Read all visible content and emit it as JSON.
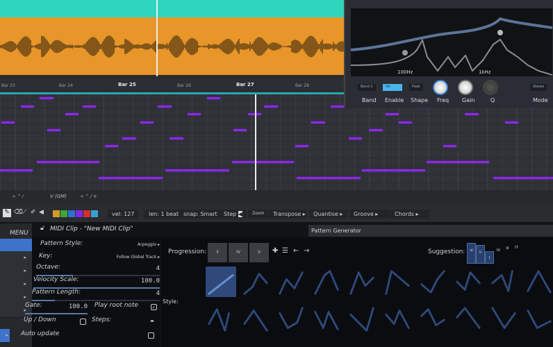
{
  "arrangement": {
    "track_colors": {
      "top": "#2fd6bd",
      "audio_clip": "#e8962a"
    }
  },
  "eq_plugin": {
    "freq_labels": [
      "100Hz",
      "1kHz"
    ],
    "controls": [
      "Band",
      "Enable",
      "Shape",
      "Freq",
      "Gain",
      "Q",
      "Mode"
    ],
    "buttons": [
      "Band 1",
      "On",
      "Peak",
      "Stereo"
    ]
  },
  "ruler": {
    "bars": [
      "Bar 23",
      "Bar 24",
      "Bar 25",
      "Bar 26",
      "Bar 27",
      "Bar 28"
    ],
    "major_bars": [
      "Bar 25",
      "Bar 27"
    ]
  },
  "piano_roll": {
    "note_color": "#8a2be2",
    "playhead_beat": 21.5,
    "notes": [
      {
        "start": 0.1,
        "len": 1,
        "row": 3
      },
      {
        "start": 1.4,
        "len": 1,
        "row": 1
      },
      {
        "start": 2.7,
        "len": 1,
        "row": 0
      },
      {
        "start": 3.2,
        "len": 1,
        "row": 4
      },
      {
        "start": 4.4,
        "len": 1,
        "row": 2
      },
      {
        "start": 5.6,
        "len": 1,
        "row": 1
      },
      {
        "start": 7.1,
        "len": 1,
        "row": 6
      },
      {
        "start": 8.3,
        "len": 1,
        "row": 5
      },
      {
        "start": 9.5,
        "len": 1,
        "row": 3
      },
      {
        "start": 10.7,
        "len": 1,
        "row": 1
      },
      {
        "start": 11.5,
        "len": 1,
        "row": 5
      },
      {
        "start": 12.7,
        "len": 1,
        "row": 2
      },
      {
        "start": 14.0,
        "len": 1,
        "row": 0
      },
      {
        "start": 15.8,
        "len": 1,
        "row": 4
      },
      {
        "start": 16.8,
        "len": 1,
        "row": 2
      },
      {
        "start": 17.9,
        "len": 1,
        "row": 1
      },
      {
        "start": 20.0,
        "len": 1,
        "row": 6
      },
      {
        "start": 21.1,
        "len": 1,
        "row": 3
      },
      {
        "start": 22.4,
        "len": 1,
        "row": 1
      },
      {
        "start": 23.6,
        "len": 1,
        "row": 5
      },
      {
        "start": 25.0,
        "len": 1,
        "row": 4
      },
      {
        "start": 26.1,
        "len": 1,
        "row": 2
      },
      {
        "start": 27.0,
        "len": 1,
        "row": 3
      },
      {
        "start": 28.3,
        "len": 1,
        "row": 1
      },
      {
        "start": 30.0,
        "len": 1,
        "row": 6
      },
      {
        "start": 31.5,
        "len": 1,
        "row": 2
      },
      {
        "start": 33.0,
        "len": 1,
        "row": 0
      },
      {
        "start": 34.2,
        "len": 1,
        "row": 3
      },
      {
        "start": 35.8,
        "len": 1,
        "row": 1
      },
      {
        "start": 0,
        "len": 2.3,
        "row": 9
      },
      {
        "start": 2.5,
        "len": 4.3,
        "row": 8
      },
      {
        "start": 6.7,
        "len": 4.4,
        "row": 10
      },
      {
        "start": 11.2,
        "len": 4.4,
        "row": 9
      },
      {
        "start": 15.7,
        "len": 4.3,
        "row": 8
      },
      {
        "start": 20.1,
        "len": 4.4,
        "row": 10
      },
      {
        "start": 24.5,
        "len": 4.4,
        "row": 9
      },
      {
        "start": 28.9,
        "len": 4.3,
        "row": 8
      },
      {
        "start": 33.4,
        "len": 4.2,
        "row": 10
      }
    ],
    "footer": {
      "chord_label": "V (GM)"
    }
  },
  "toolbar": {
    "tools": [
      "pencil",
      "eraser",
      "line",
      "brush",
      "speaker"
    ],
    "swatches": [
      "#d49a2a",
      "#3aa83a",
      "#2f6fd0",
      "#7a2be0",
      "#d03030",
      "#3aa0d0"
    ],
    "vel": "vel: 127",
    "len": "len: 1 beat",
    "snap": "snap: Smart",
    "step": "Step",
    "zoom": "Zoom",
    "menus": [
      "Transpose",
      "Quantise",
      "Groove",
      "Chords"
    ]
  },
  "sidebar": {
    "menu": "MENU",
    "selected_index": 0
  },
  "clip": {
    "title": "MIDI Clip - \"New MIDI Clip\""
  },
  "generator": {
    "tab": "Pattern Generator",
    "pattern_style_label": "Pattern Style:",
    "pattern_style": "Arpeggio",
    "key_label": "Key:",
    "key": "Follow Global Track",
    "octave_label": "Octave:",
    "octave": "4",
    "octave_fraction": 0.3,
    "velocity_label": "Velocity Scale:",
    "velocity": "100.0",
    "velocity_fraction": 1.0,
    "length_label": "Pattern Length:",
    "length": "4",
    "length_fraction": 0.18,
    "gate_label": "Gate:",
    "gate": "100.0",
    "gate_fraction": 1.0,
    "play_root_label": "Play root note",
    "play_root": true,
    "updown_label": "Up / Down",
    "updown": false,
    "steps_label": "Steps:",
    "auto_update_label": "Auto update",
    "auto_update": false,
    "progression_label": "Progression:",
    "progression": [
      "ii",
      "IV",
      "V"
    ],
    "suggestion_label": "Suggestion:",
    "suggestions": [
      {
        "label": "vi",
        "strength": 1.0
      },
      {
        "label": "ii",
        "strength": 0.9
      },
      {
        "label": "I",
        "strength": 0.6
      },
      {
        "label": "IV",
        "strength": 0.35
      },
      {
        "label": "iii",
        "strength": 0.15
      },
      {
        "label": "I7",
        "strength": 0.08
      }
    ],
    "style_label": "Style:",
    "selected_style_index": 0,
    "accent": "#2f4a7a"
  }
}
